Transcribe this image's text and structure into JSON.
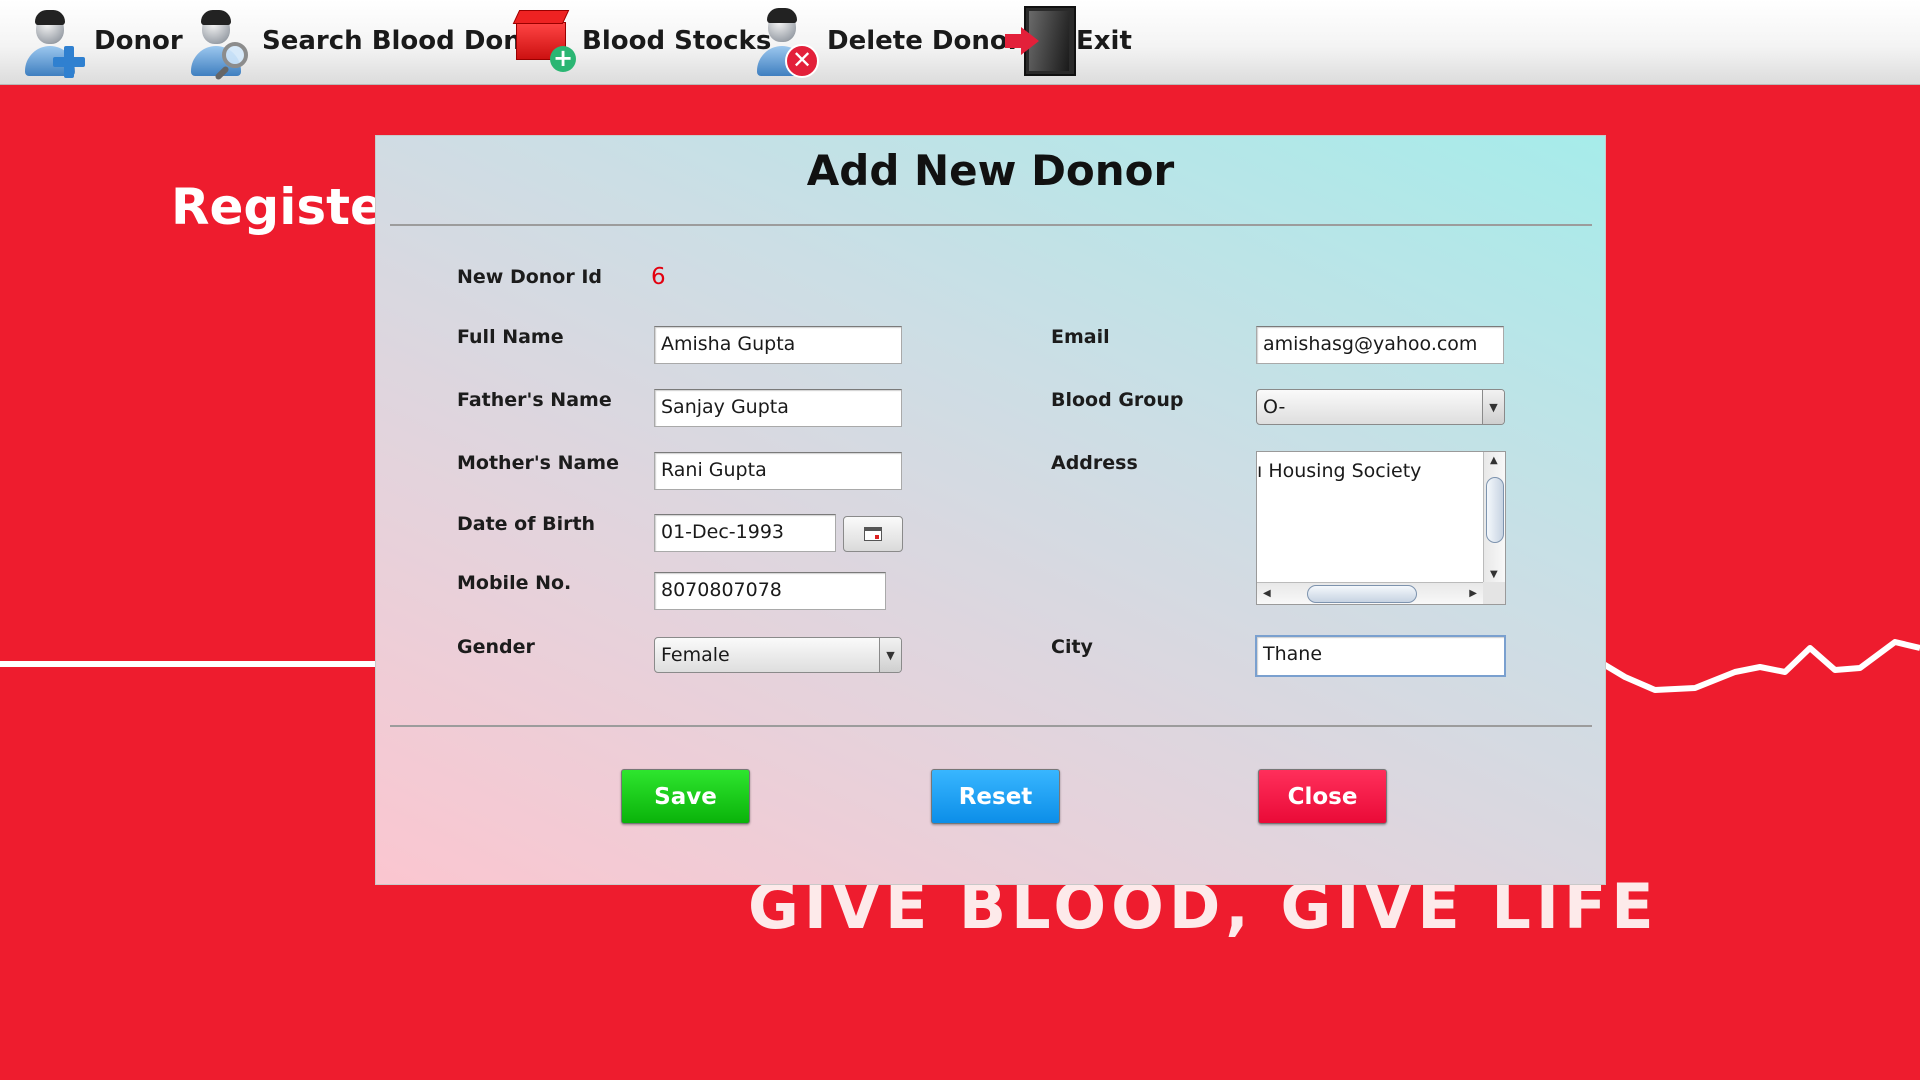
{
  "toolbar": {
    "items": [
      {
        "label": "Donor",
        "icon": "add-user-icon"
      },
      {
        "label": "Search Blood Donor",
        "icon": "search-user-icon"
      },
      {
        "label": "Blood Stocks",
        "icon": "blood-stock-icon"
      },
      {
        "label": "Delete Donor",
        "icon": "delete-user-icon"
      },
      {
        "label": "Exit",
        "icon": "exit-door-icon"
      }
    ]
  },
  "background": {
    "heading": "Register",
    "slogan": "GIVE BLOOD, GIVE LIFE",
    "color": "#ee1c2e"
  },
  "dialog": {
    "title": "Add New Donor",
    "labels": {
      "donor_id": "New Donor Id",
      "full_name": "Full Name",
      "father_name": "Father's Name",
      "mother_name": "Mother's Name",
      "dob": "Date of Birth",
      "mobile": "Mobile No.",
      "gender": "Gender",
      "email": "Email",
      "blood_group": "Blood Group",
      "address": "Address",
      "city": "City"
    },
    "values": {
      "donor_id": "6",
      "full_name": "Amisha Gupta",
      "father_name": "Sanjay Gupta",
      "mother_name": "Rani Gupta",
      "dob": "01-Dec-1993",
      "mobile": "8070807078",
      "gender": "Female",
      "email": "amishasg@yahoo.com",
      "blood_group": "O-",
      "address": "ı Housing Society",
      "city": "Thane"
    },
    "buttons": {
      "save": "Save",
      "reset": "Reset",
      "close": "Close"
    },
    "colors": {
      "save": "#12c512",
      "reset": "#1aa0f5",
      "close": "#f3143f",
      "donor_id": "#e3000f"
    }
  }
}
